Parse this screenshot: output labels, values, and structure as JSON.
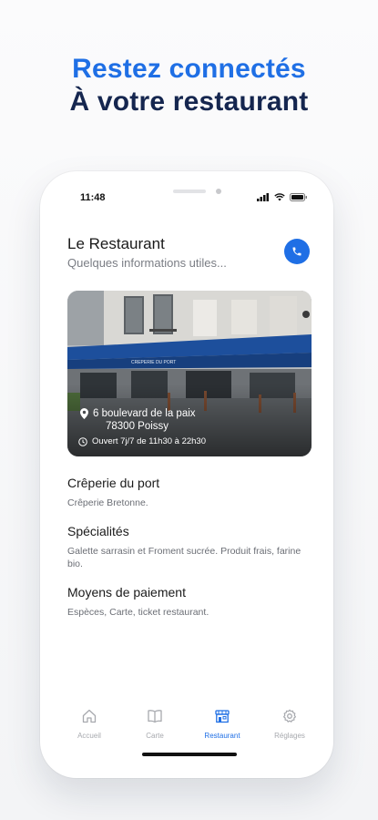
{
  "headline": {
    "line1": "Restez connectés",
    "line2": "À votre restaurant"
  },
  "status_bar": {
    "time": "11:48"
  },
  "header": {
    "title": "Le Restaurant",
    "subtitle": "Quelques informations utiles...",
    "call_icon": "phone-icon"
  },
  "photo": {
    "sign_text": "CREPERIE DU PORT",
    "address_line1": "6 boulevard de la paix",
    "address_line2": "78300 Poissy",
    "hours": "Ouvert 7j/7 de 11h30 à 22h30"
  },
  "sections": [
    {
      "title": "Crêperie du port",
      "text": "Crêperie Bretonne."
    },
    {
      "title": "Spécialités",
      "text": "Galette sarrasin et Froment sucrée. Produit frais, farine bio."
    },
    {
      "title": "Moyens de paiement",
      "text": "Espèces, Carte, ticket restaurant."
    }
  ],
  "tabs": [
    {
      "label": "Accueil",
      "icon": "home-icon"
    },
    {
      "label": "Carte",
      "icon": "book-icon"
    },
    {
      "label": "Restaurant",
      "icon": "storefront-icon",
      "active": true
    },
    {
      "label": "Réglages",
      "icon": "gear-icon"
    }
  ],
  "colors": {
    "accent": "#1f6fe5",
    "headline_dark": "#15264f"
  }
}
